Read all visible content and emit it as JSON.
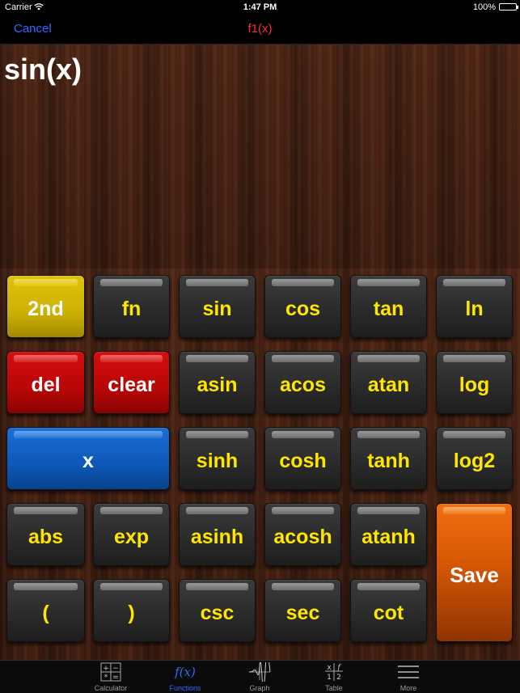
{
  "status": {
    "carrier": "Carrier",
    "time": "1:47 PM",
    "battery": "100%"
  },
  "nav": {
    "cancel": "Cancel",
    "title": "f1(x)"
  },
  "display": {
    "expression": "sin(x)"
  },
  "colors": {
    "key_text": "#ffe600",
    "accent": "#2f6bff",
    "title": "#ff2a2a",
    "yellow": "#d6b906",
    "red": "#c00a0a",
    "blue": "#1262c8",
    "orange": "#e0620a"
  },
  "keys": {
    "second": "2nd",
    "fn": "fn",
    "sin": "sin",
    "cos": "cos",
    "tan": "tan",
    "ln": "ln",
    "del": "del",
    "clear": "clear",
    "asin": "asin",
    "acos": "acos",
    "atan": "atan",
    "log": "log",
    "x": "x",
    "sinh": "sinh",
    "cosh": "cosh",
    "tanh": "tanh",
    "log2": "log2",
    "abs": "abs",
    "exp": "exp",
    "asinh": "asinh",
    "acosh": "acosh",
    "atanh": "atanh",
    "lparen": "(",
    "rparen": ")",
    "csc": "csc",
    "sec": "sec",
    "cot": "cot",
    "save": "Save"
  },
  "tabs": {
    "calculator": {
      "label": "Calculator",
      "icon": "calculator-icon"
    },
    "functions": {
      "label": "Functions",
      "icon": "function-icon",
      "icon_text": "f(x)"
    },
    "graph": {
      "label": "Graph",
      "icon": "graph-icon"
    },
    "table": {
      "label": "Table",
      "icon": "table-icon"
    },
    "more": {
      "label": "More",
      "icon": "menu-icon"
    }
  }
}
